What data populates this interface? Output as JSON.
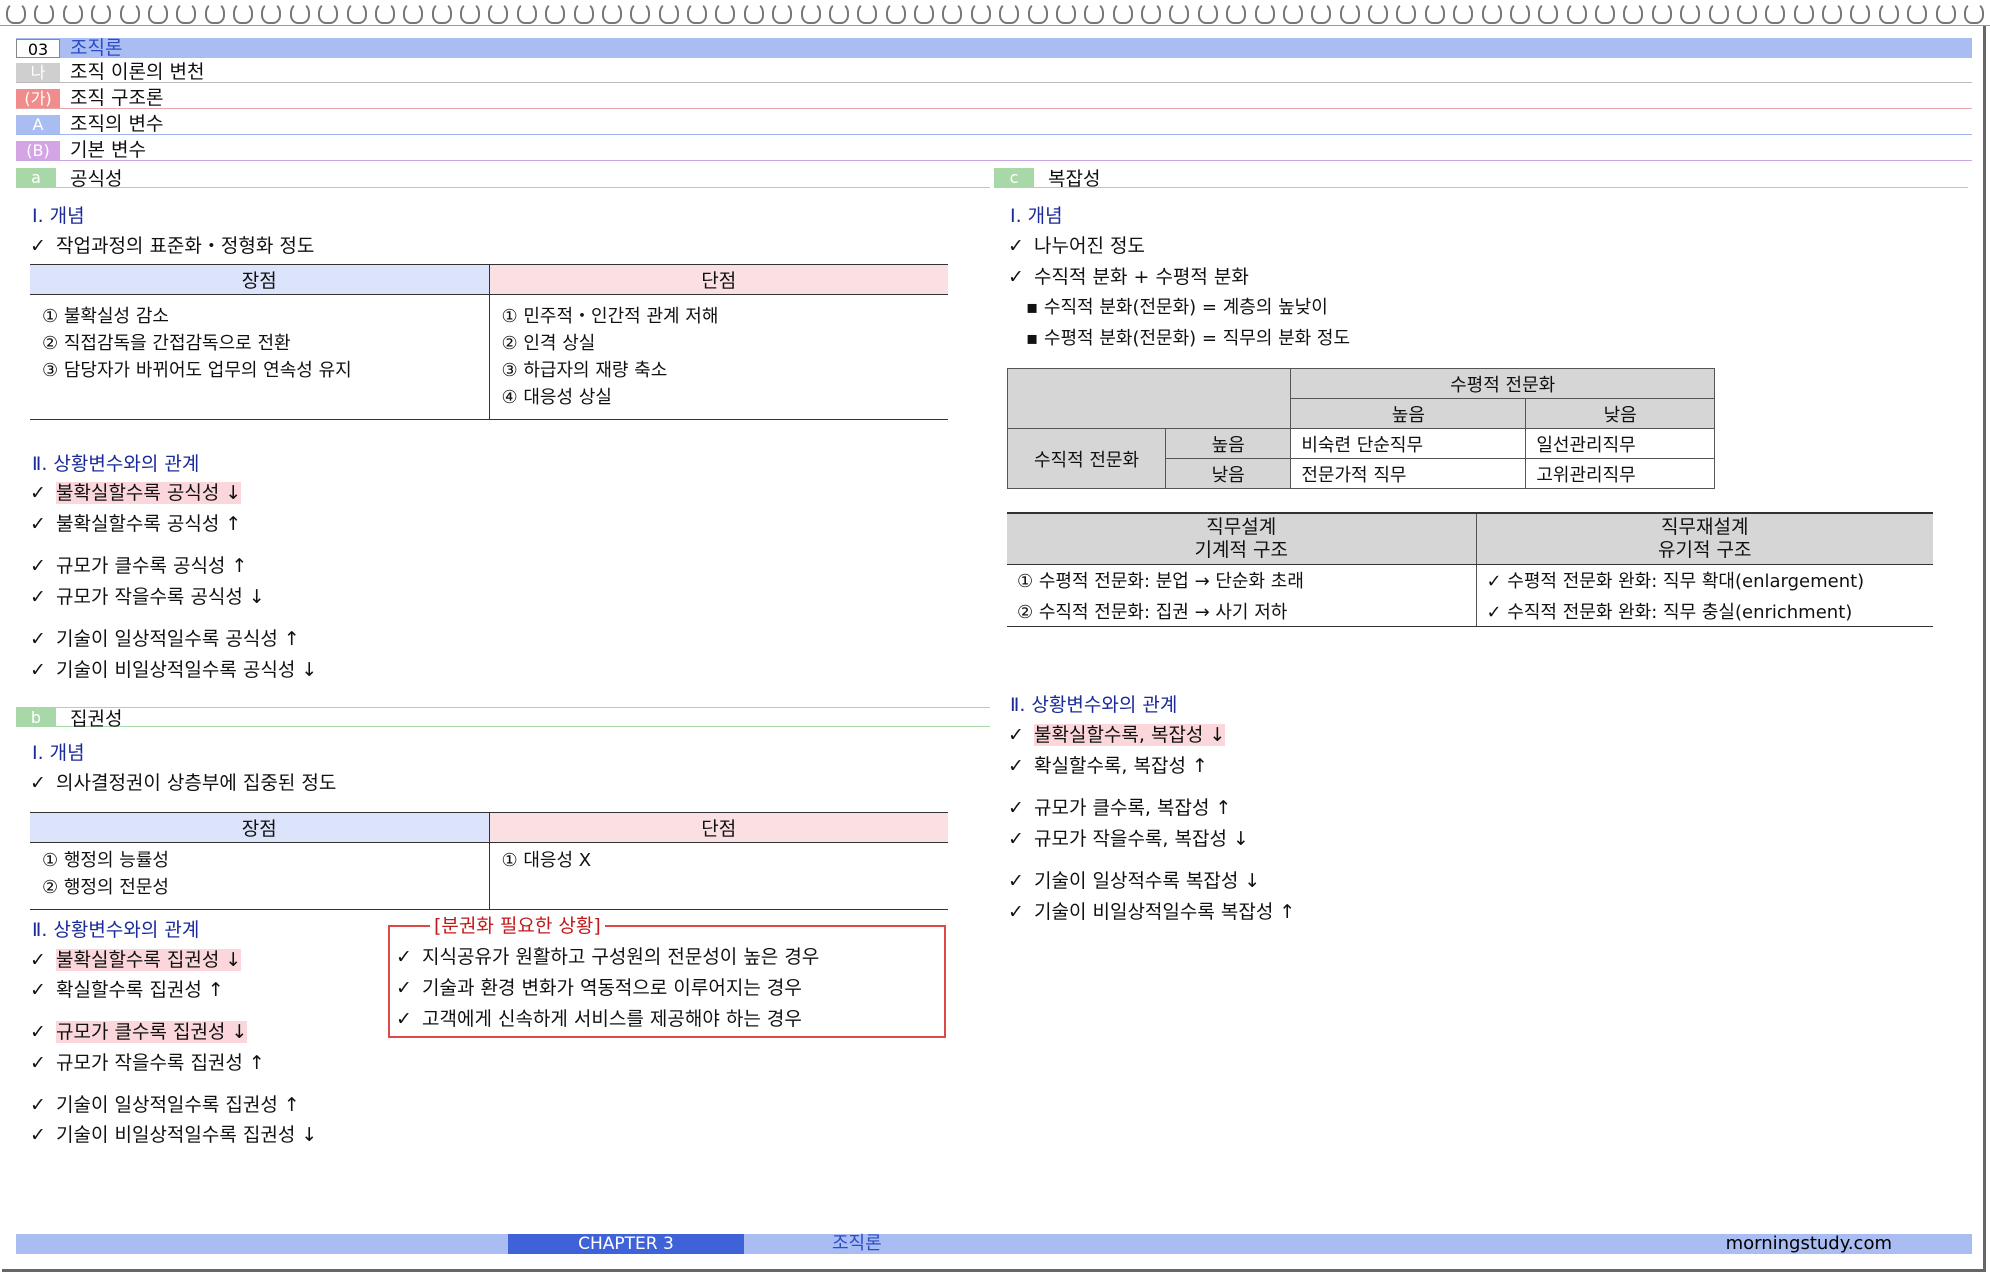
{
  "header": {
    "rows": [
      {
        "tag": "03",
        "text": "조직론"
      },
      {
        "tag": "나",
        "text": "조직 이론의 변천"
      },
      {
        "tag": "(가)",
        "text": "조직 구조론"
      },
      {
        "tag": "A",
        "text": "조직의 변수"
      },
      {
        "tag": "(B)",
        "text": "기본 변수"
      }
    ]
  },
  "left": {
    "a": {
      "tag": "a",
      "title": "공식성",
      "concept_heading": "Ⅰ. 개념",
      "concept": "작업과정의 표준화・정형화 정도",
      "pros_header": "장점",
      "cons_header": "단점",
      "pros": [
        "① 불확실성 감소",
        "② 직접감독을 간접감독으로 전환",
        "③ 담당자가 바뀌어도 업무의 연속성 유지"
      ],
      "cons": [
        "① 민주적・인간적 관계 저해",
        "② 인격 상실",
        "③ 하급자의 재량 축소",
        "④ 대응성 상실"
      ],
      "relation_heading": "Ⅱ. 상황변수와의 관계",
      "relations": [
        "불확실할수록 공식성 ↓",
        "불확실할수록 공식성 ↑",
        "규모가 클수록 공식성 ↑",
        "규모가 작을수록 공식성 ↓",
        "기술이 일상적일수록 공식성 ↑",
        "기술이 비일상적일수록 공식성 ↓"
      ]
    },
    "b": {
      "tag": "b",
      "title": "집권성",
      "concept_heading": "Ⅰ. 개념",
      "concept": "의사결정권이 상층부에 집중된 정도",
      "pros_header": "장점",
      "cons_header": "단점",
      "pros": [
        "① 행정의 능률성",
        "② 행정의 전문성"
      ],
      "cons": [
        "① 대응성 X"
      ],
      "relation_heading": "Ⅱ. 상황변수와의 관계",
      "relations": [
        "불확실할수록 집권성 ↓",
        "확실할수록 집권성 ↑",
        "규모가 클수록 집권성 ↓",
        "규모가 작을수록 집권성 ↑",
        "기술이 일상적일수록 집권성 ↑",
        "기술이 비일상적일수록 집권성 ↓"
      ],
      "box_title": "[분권화 필요한 상황]",
      "box_items": [
        "지식공유가 원활하고 구성원의 전문성이 높은 경우",
        "기술과 환경 변화가 역동적으로 이루어지는 경우",
        "고객에게 신속하게 서비스를 제공해야 하는 경우"
      ]
    }
  },
  "right": {
    "c": {
      "tag": "c",
      "title": "복잡성",
      "concept_heading": "Ⅰ. 개념",
      "concepts": [
        "나누어진 정도",
        "수직적 분화 + 수평적 분화"
      ],
      "sub": [
        "수직적 분화(전문화) = 계층의 높낮이",
        "수평적 분화(전문화) = 직무의 분화 정도"
      ],
      "matrix": {
        "col_group": "수평적 전문화",
        "col_high": "높음",
        "col_low": "낮음",
        "row_group": "수직적 전문화",
        "row_high": "높음",
        "row_low": "낮음",
        "hh": "비숙련 단순직무",
        "hl": "일선관리직무",
        "lh": "전문가적 직무",
        "ll": "고위관리직무"
      },
      "job": {
        "left_h1": "직무설계",
        "left_h2": "기계적 구조",
        "right_h1": "직무재설계",
        "right_h2": "유기적 구조",
        "left_rows": [
          "① 수평적 전문화: 분업 → 단순화 초래",
          "② 수직적 전문화: 집권 → 사기 저하"
        ],
        "right_rows": [
          "✓ 수평적 전문화 완화: 직무 확대(enlargement)",
          "✓ 수직적 전문화 완화: 직무 충실(enrichment)"
        ]
      },
      "relation_heading": "Ⅱ. 상황변수와의 관계",
      "relations": [
        "불확실할수록, 복잡성 ↓",
        "확실할수록, 복잡성 ↑",
        "규모가 클수록, 복잡성 ↑",
        "규모가 작을수록, 복잡성 ↓",
        "기술이 일상적수록 복잡성 ↓",
        "기술이 비일상적일수록 복잡성 ↑"
      ]
    }
  },
  "footer": {
    "chapter": "CHAPTER 3",
    "title": "조직론",
    "site": "morningstudy.com"
  }
}
